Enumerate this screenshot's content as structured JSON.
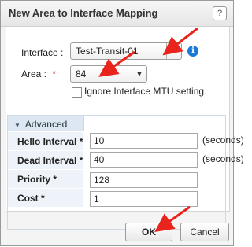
{
  "dialog": {
    "title": "New Area to Interface Mapping",
    "help_glyph": "?"
  },
  "form": {
    "interface_label": "Interface :",
    "interface_value": "Test-Transit-01",
    "area_label": "Area :",
    "area_required": "*",
    "area_value": "84",
    "ignore_mtu_label": "Ignore Interface MTU setting",
    "ignore_mtu_checked": false,
    "info_glyph": "i"
  },
  "advanced": {
    "header": "Advanced",
    "rows": [
      {
        "label": "Hello Interval *",
        "value": "10",
        "unit": "(seconds)"
      },
      {
        "label": "Dead Interval *",
        "value": "40",
        "unit": "(seconds)"
      },
      {
        "label": "Priority *",
        "value": "128"
      },
      {
        "label": "Cost *",
        "value": "1"
      }
    ]
  },
  "footer": {
    "ok": "OK",
    "cancel": "Cancel"
  },
  "colors": {
    "accent": "#1b7ad6",
    "annotation_red": "#e8241c",
    "required": "#d33333"
  },
  "icons": {
    "help": "question-icon",
    "info": "info-icon",
    "dropdown": "chevron-down-icon",
    "collapse": "triangle-down-icon"
  }
}
